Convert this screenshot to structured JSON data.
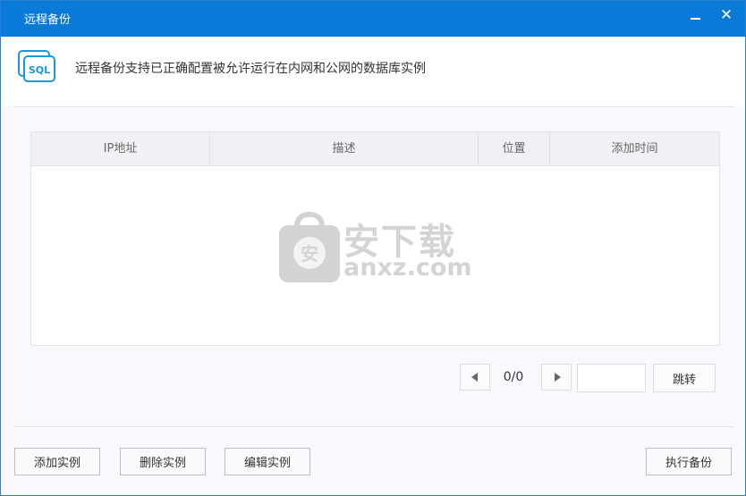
{
  "window": {
    "title": "远程备份",
    "minimize_label": "",
    "close_label": "✕"
  },
  "header": {
    "icon_label": "SQL",
    "description": "远程备份支持已正确配置被允许运行在内网和公网的数据库实例"
  },
  "table": {
    "columns": [
      "IP地址",
      "描述",
      "位置",
      "添加时间"
    ],
    "rows": []
  },
  "watermark": {
    "cn_text": "安下载",
    "en_text": "anxz.com",
    "badge_char": "安"
  },
  "pager": {
    "count_text": "0/0",
    "page_input_value": "",
    "jump_label": "跳转"
  },
  "actions": {
    "add_label": "添加实例",
    "delete_label": "删除实例",
    "edit_label": "编辑实例",
    "run_label": "执行备份"
  },
  "colors": {
    "titlebar": "#0a7ad9",
    "icon_accent": "#1a9ad6"
  }
}
